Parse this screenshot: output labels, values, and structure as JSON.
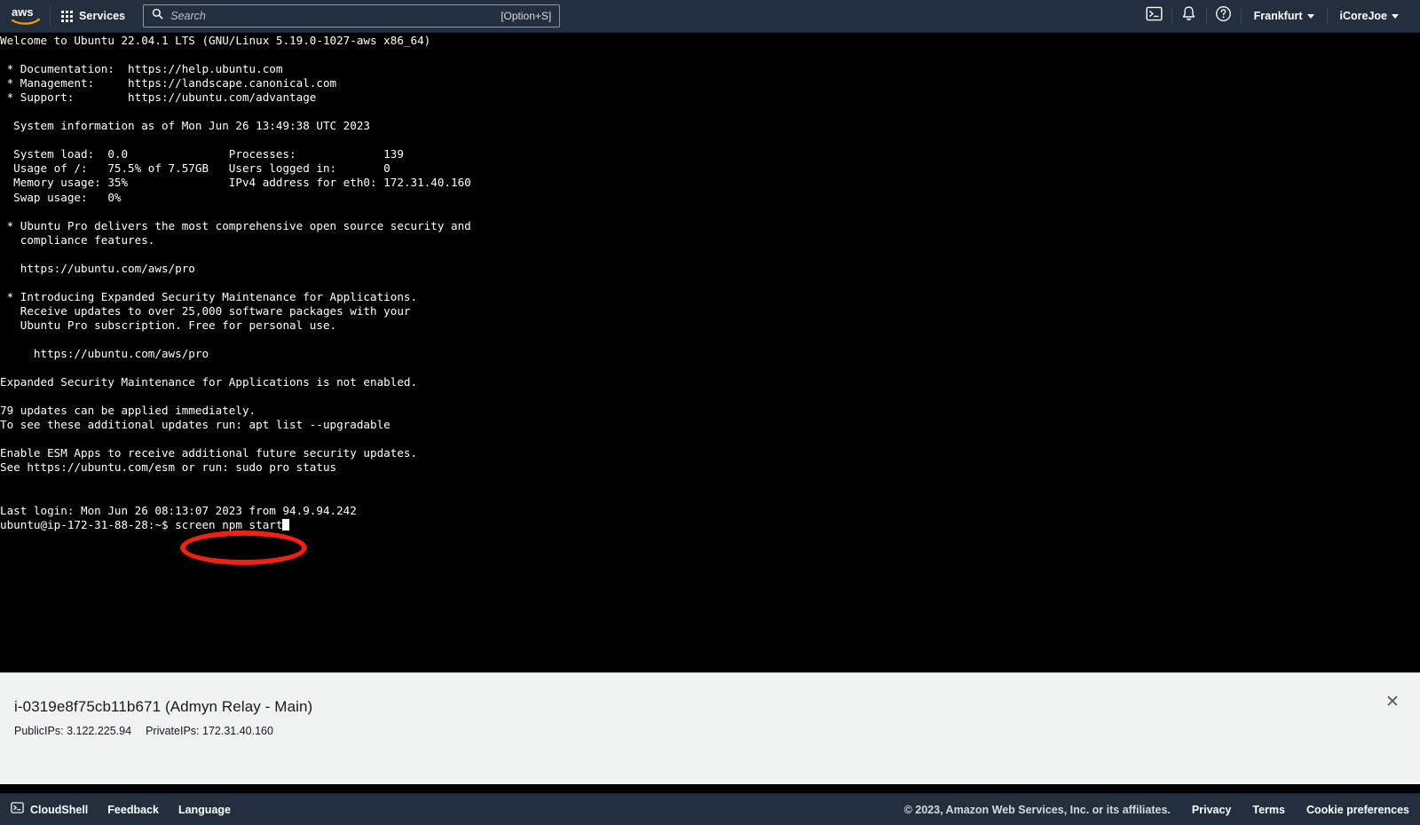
{
  "topnav": {
    "logo_alt": "aws",
    "services_label": "Services",
    "search": {
      "placeholder": "Search",
      "value": "",
      "hint": "[Option+S]"
    },
    "icons": {
      "cloudshell": "cloudshell-icon",
      "notifications": "bell-icon",
      "help": "question-circle-icon"
    },
    "region_label": "Frankfurt",
    "account_label": "iCoreJoe"
  },
  "terminal": {
    "lines": [
      "Welcome to Ubuntu 22.04.1 LTS (GNU/Linux 5.19.0-1027-aws x86_64)",
      "",
      " * Documentation:  https://help.ubuntu.com",
      " * Management:     https://landscape.canonical.com",
      " * Support:        https://ubuntu.com/advantage",
      "",
      "  System information as of Mon Jun 26 13:49:38 UTC 2023",
      "",
      "  System load:  0.0               Processes:             139",
      "  Usage of /:   75.5% of 7.57GB   Users logged in:       0",
      "  Memory usage: 35%               IPv4 address for eth0: 172.31.40.160",
      "  Swap usage:   0%",
      "",
      " * Ubuntu Pro delivers the most comprehensive open source security and",
      "   compliance features.",
      "",
      "   https://ubuntu.com/aws/pro",
      "",
      " * Introducing Expanded Security Maintenance for Applications.",
      "   Receive updates to over 25,000 software packages with your",
      "   Ubuntu Pro subscription. Free for personal use.",
      "",
      "     https://ubuntu.com/aws/pro",
      "",
      "Expanded Security Maintenance for Applications is not enabled.",
      "",
      "79 updates can be applied immediately.",
      "To see these additional updates run: apt list --upgradable",
      "",
      "Enable ESM Apps to receive additional future security updates.",
      "See https://ubuntu.com/esm or run: sudo pro status",
      "",
      "",
      "Last login: Mon Jun 26 08:13:07 2023 from 94.9.94.242"
    ],
    "prompt": "ubuntu@ip-172-31-88-28:~$ ",
    "command": "screen npm start",
    "annotation": {
      "shape": "ellipse",
      "color": "#ee2211",
      "target": "screen npm start"
    }
  },
  "instance_panel": {
    "title": "i-0319e8f75cb11b671 (Admyn Relay - Main)",
    "public_ips_label": "PublicIPs:",
    "public_ips_value": "3.122.225.94",
    "private_ips_label": "PrivateIPs:",
    "private_ips_value": "172.31.40.160",
    "close_label": "✕"
  },
  "footer": {
    "cloudshell_label": "CloudShell",
    "feedback_label": "Feedback",
    "language_label": "Language",
    "copyright": "© 2023, Amazon Web Services, Inc. or its affiliates.",
    "privacy_label": "Privacy",
    "terms_label": "Terms",
    "cookie_label": "Cookie preferences"
  },
  "colors": {
    "nav_background": "#232f3e",
    "terminal_background": "#000000",
    "panel_background": "#f1f3f3",
    "annotation_red": "#ee2211",
    "aws_orange": "#ff9900"
  }
}
